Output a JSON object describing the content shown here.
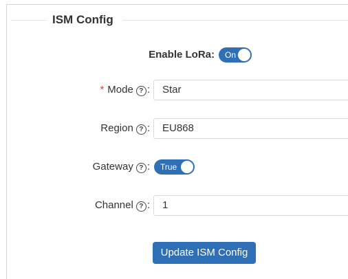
{
  "section": {
    "title": "ISM Config"
  },
  "fields": {
    "enable_lora": {
      "label": "Enable LoRa:",
      "toggle_text": "On",
      "enabled": true
    },
    "mode": {
      "required_mark": "*",
      "label": "Mode",
      "help_icon": "question-circle-icon",
      "colon": ":",
      "value": "Star"
    },
    "region": {
      "label": "Region",
      "help_icon": "question-circle-icon",
      "colon": ":",
      "value": "EU868"
    },
    "gateway": {
      "label": "Gateway",
      "help_icon": "question-circle-icon",
      "colon": ":",
      "toggle_text": "True",
      "enabled": true
    },
    "channel": {
      "label": "Channel",
      "help_icon": "question-circle-icon",
      "colon": ":",
      "value": "1"
    }
  },
  "help_glyph": "?",
  "actions": {
    "update_label": "Update ISM Config"
  },
  "colors": {
    "primary": "#2e6fb5",
    "required": "#e0413a",
    "border": "#d9d9d9"
  }
}
